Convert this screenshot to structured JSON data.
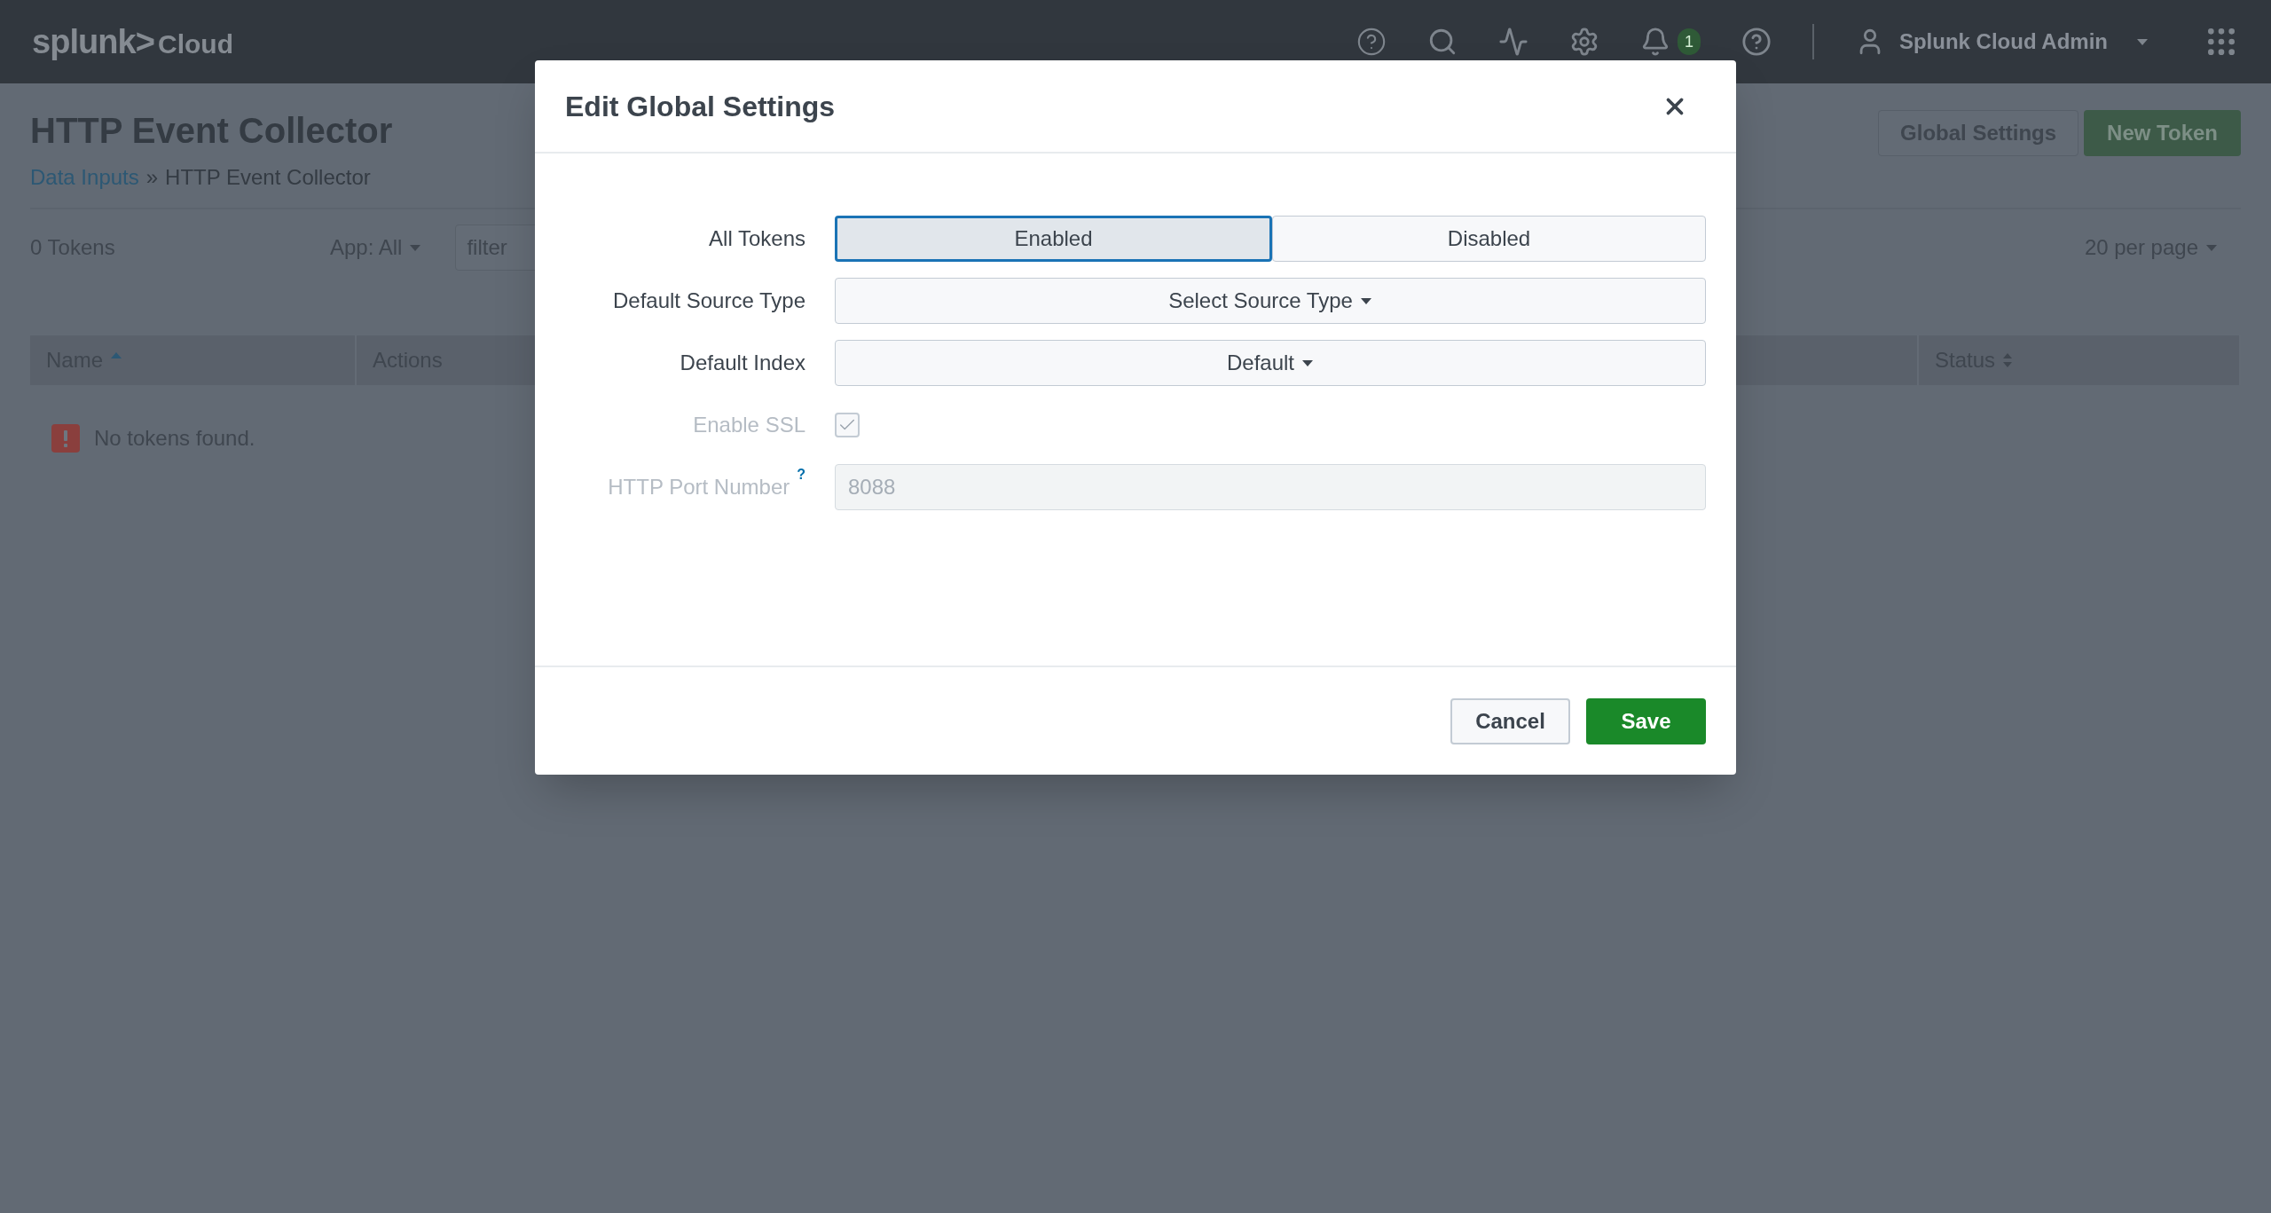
{
  "top_bar": {
    "logo": {
      "brand": "splunk>",
      "product": "Cloud"
    },
    "notification_count": "1",
    "user": "Splunk Cloud Admin"
  },
  "page": {
    "title": "HTTP Event Collector",
    "breadcrumb": {
      "link": "Data Inputs",
      "separator": "»",
      "current": "HTTP Event Collector"
    },
    "buttons": [
      {
        "label": "Global Settings",
        "kind": "secondary"
      },
      {
        "label": "New Token",
        "kind": "primary"
      }
    ],
    "token_count": "0 Tokens",
    "app_filter": "App: All",
    "filter": {
      "placeholder": "filter"
    },
    "per_page": "20 per page",
    "table": {
      "columns": [
        {
          "label": "Name",
          "kind": "sorted"
        },
        {
          "label": "Actions",
          "kind": "plain"
        },
        {
          "label": "Status",
          "kind": "sortable"
        }
      ],
      "empty_message": "No tokens found."
    }
  },
  "dialog": {
    "title": "Edit Global Settings",
    "fields": [
      {
        "label": "All Tokens",
        "kind": "toggle",
        "disabled": false,
        "options": [
          {
            "label": "Enabled",
            "selected": true
          },
          {
            "label": "Disabled",
            "selected": false
          }
        ]
      },
      {
        "label": "Default Source Type",
        "kind": "select",
        "disabled": false,
        "value": "Select Source Type"
      },
      {
        "label": "Default Index",
        "kind": "select",
        "disabled": false,
        "value": "Default"
      },
      {
        "label": "Enable SSL",
        "kind": "checkbox",
        "disabled": true,
        "checked": true
      },
      {
        "label": "HTTP Port Number",
        "help": "?",
        "kind": "text",
        "disabled": true,
        "value": "8088"
      }
    ],
    "buttons": [
      {
        "label": "Cancel",
        "kind": "secondary"
      },
      {
        "label": "Save",
        "kind": "primary"
      }
    ]
  }
}
